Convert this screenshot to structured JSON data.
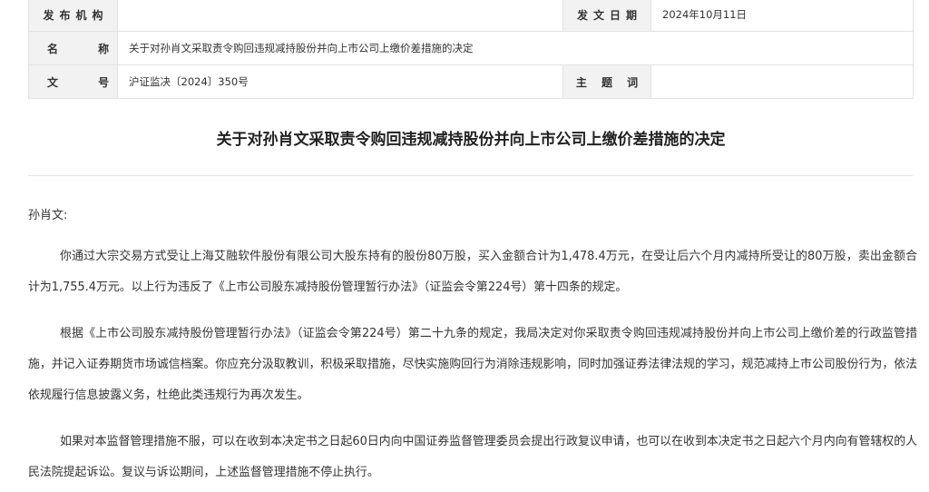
{
  "meta": {
    "issuer_label": "发布机构",
    "issuer_value": "",
    "date_label": "发文日期",
    "date_value": "2024年10月11日",
    "name_label": "名 称",
    "name_value": "关于对孙肖文采取责令购回违规减持股份并向上市公司上缴价差措施的决定",
    "doc_no_label": "文 号",
    "doc_no_value": "沪证监决〔2024〕350号",
    "subject_label": "主 题 词",
    "subject_value": ""
  },
  "document": {
    "title": "关于对孙肖文采取责令购回违规减持股份并向上市公司上缴价差措施的决定",
    "salutation": "孙肖文:",
    "paragraphs": [
      "你通过大宗交易方式受让上海艾融软件股份有限公司大股东持有的股份80万股，买入金额合计为1,478.4万元，在受让后六个月内减持所受让的80万股，卖出金额合计为1,755.4万元。以上行为违反了《上市公司股东减持股份管理暂行办法》（证监会令第224号）第十四条的规定。",
      "根据《上市公司股东减持股份管理暂行办法》（证监会令第224号）第二十九条的规定，我局决定对你采取责令购回违规减持股份并向上市公司上缴价差的行政监管措施，并记入证券期货市场诚信档案。你应充分汲取教训，积极采取措施，尽快实施购回行为消除违规影响，同时加强证券法律法规的学习，规范减持上市公司股份行为，依法依规履行信息披露义务，杜绝此类违规行为再次发生。",
      "如果对本监督管理措施不服，可以在收到本决定书之日起60日内向中国证券监督管理委员会提出行政复议申请，也可以在收到本决定书之日起六个月内向有管辖权的人民法院提起诉讼。复议与诉讼期间，上述监督管理措施不停止执行。"
    ]
  }
}
